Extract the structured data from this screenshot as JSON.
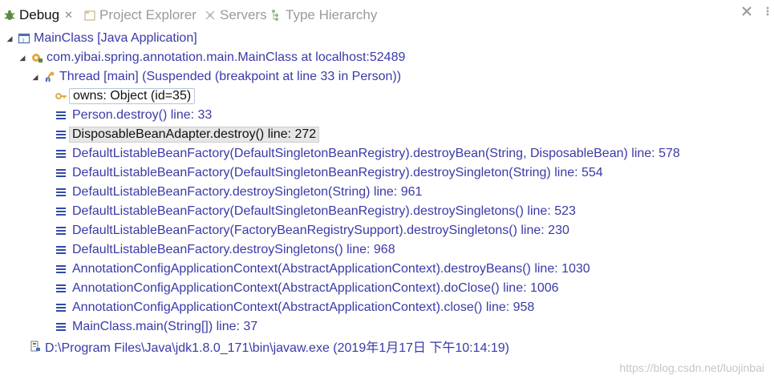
{
  "tabs": {
    "debug": "Debug",
    "debug_close": "✕",
    "project_explorer": "Project Explorer",
    "servers": "Servers",
    "type_hierarchy": "Type Hierarchy"
  },
  "tree": {
    "launch": "MainClass [Java Application]",
    "target": "com.yibai.spring.annotation.main.MainClass at localhost:52489",
    "thread": "Thread [main] (Suspended (breakpoint at line 33 in Person))",
    "owns": "owns: Object  (id=35)",
    "frames": [
      "Person.destroy() line: 33",
      "DisposableBeanAdapter.destroy() line: 272",
      "DefaultListableBeanFactory(DefaultSingletonBeanRegistry).destroyBean(String, DisposableBean) line: 578",
      "DefaultListableBeanFactory(DefaultSingletonBeanRegistry).destroySingleton(String) line: 554",
      "DefaultListableBeanFactory.destroySingleton(String) line: 961",
      "DefaultListableBeanFactory(DefaultSingletonBeanRegistry).destroySingletons() line: 523",
      "DefaultListableBeanFactory(FactoryBeanRegistrySupport).destroySingletons() line: 230",
      "DefaultListableBeanFactory.destroySingletons() line: 968",
      "AnnotationConfigApplicationContext(AbstractApplicationContext).destroyBeans() line: 1030",
      "AnnotationConfigApplicationContext(AbstractApplicationContext).doClose() line: 1006",
      "AnnotationConfigApplicationContext(AbstractApplicationContext).close() line: 958",
      "MainClass.main(String[]) line: 37"
    ],
    "process": "D:\\Program Files\\Java\\jdk1.8.0_171\\bin\\javaw.exe (2019年1月17日 下午10:14:19)"
  },
  "watermark": "https://blog.csdn.net/luojinbai"
}
